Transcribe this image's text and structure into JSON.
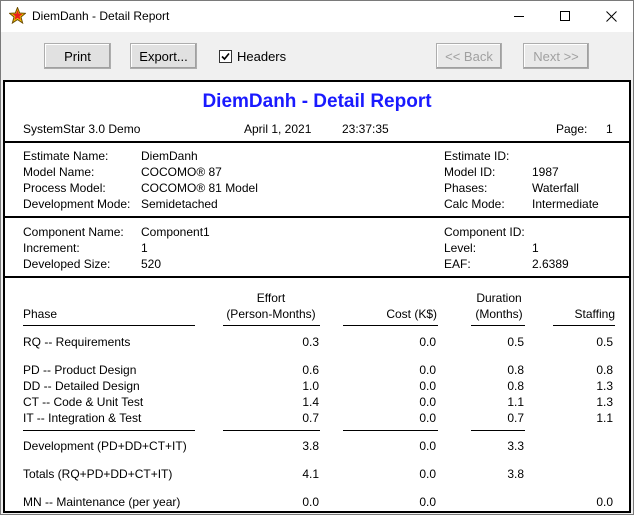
{
  "window": {
    "title": "DiemDanh - Detail Report"
  },
  "toolbar": {
    "print_label": "Print",
    "export_label": "Export...",
    "headers_label": "Headers",
    "headers_checked": true,
    "back_label": "<< Back",
    "next_label": "Next >>"
  },
  "report": {
    "title": "DiemDanh - Detail Report",
    "product": "SystemStar 3.0 Demo",
    "date": "April 1, 2021",
    "time": "23:37:35",
    "page_label": "Page:",
    "page_number": "1",
    "estimate": {
      "left_labels": [
        "Estimate Name:",
        "Model Name:",
        "Process Model:",
        "Development Mode:"
      ],
      "left_values": [
        "DiemDanh",
        "COCOMO® 87",
        "COCOMO® 81 Model",
        "Semidetached"
      ],
      "right_labels": [
        "Estimate ID:",
        "Model ID:",
        "Phases:",
        "Calc Mode:"
      ],
      "right_values": [
        "",
        "1987",
        "Waterfall",
        "Intermediate"
      ]
    },
    "component": {
      "left_labels": [
        "Component Name:",
        "Increment:",
        "Developed Size:"
      ],
      "left_values": [
        "Component1",
        "1",
        "520"
      ],
      "right_labels": [
        "Component ID:",
        "Level:",
        "EAF:"
      ],
      "right_values": [
        "",
        "1",
        "2.6389"
      ]
    },
    "table": {
      "headers": {
        "phase": "Phase",
        "effort_top": "Effort",
        "effort_bottom": "(Person-Months)",
        "cost": "Cost (K$)",
        "duration_top": "Duration",
        "duration_bottom": "(Months)",
        "staffing": "Staffing"
      },
      "rows": [
        {
          "phase": "RQ  --  Requirements",
          "effort": "0.3",
          "cost": "0.0",
          "duration": "0.5",
          "staffing": "0.5"
        },
        {
          "phase": "PD  --  Product Design",
          "effort": "0.6",
          "cost": "0.0",
          "duration": "0.8",
          "staffing": "0.8"
        },
        {
          "phase": "DD  --  Detailed Design",
          "effort": "1.0",
          "cost": "0.0",
          "duration": "0.8",
          "staffing": "1.3"
        },
        {
          "phase": "CT  --  Code & Unit Test",
          "effort": "1.4",
          "cost": "0.0",
          "duration": "1.1",
          "staffing": "1.3"
        },
        {
          "phase": "IT   --  Integration & Test",
          "effort": "0.7",
          "cost": "0.0",
          "duration": "0.7",
          "staffing": "1.1"
        },
        {
          "phase": "Development (PD+DD+CT+IT)",
          "effort": "3.8",
          "cost": "0.0",
          "duration": "3.3",
          "staffing": ""
        },
        {
          "phase": "Totals (RQ+PD+DD+CT+IT)",
          "effort": "4.1",
          "cost": "0.0",
          "duration": "3.8",
          "staffing": ""
        },
        {
          "phase": "MN --  Maintenance (per year)",
          "effort": "0.0",
          "cost": "0.0",
          "duration": "",
          "staffing": "0.0"
        }
      ]
    }
  },
  "colors": {
    "report_title": "#1a1aff"
  },
  "icons": {
    "app": "star-icon",
    "minimize": "minimize-icon",
    "maximize": "maximize-icon",
    "close": "close-icon",
    "check": "check-icon"
  }
}
